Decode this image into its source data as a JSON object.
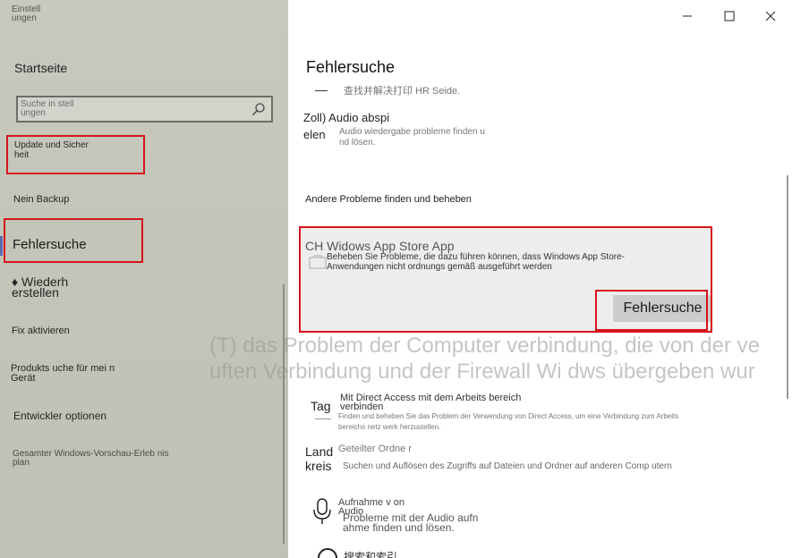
{
  "sidebar": {
    "app_title": "Einstell ungen",
    "home": "Startseite",
    "search_placeholder": "Suche in stell ungen",
    "items": {
      "update": "Update und Sicher heit",
      "backup": "Nein Backup",
      "troubleshoot": "Fehlersuche",
      "recovery": "♦ Wiederh erstellen",
      "activation": "Fix aktivieren",
      "find_device": "Produkts uche für mei n Gerät",
      "developer": "Entwickler optionen",
      "insider": "Gesamter Windows-Vorschau-Erleb nis plan"
    }
  },
  "main": {
    "title": "Fehlersuche",
    "top_fragment": "查找并解决打印 HR Seide.",
    "audio": {
      "title": "Zoll) Audio abspi elen",
      "desc": "Audio wiedergabe probleme finden u nd lösen."
    },
    "other_heading": "Andere Probleme finden und beheben",
    "store_app": {
      "title": "CH Widows App Store App",
      "desc": "Beheben Sie Probleme, die dazu führen können, dass Windows App Store-Anwendungen nicht ordnungs gemäß ausgeführt werden",
      "button": "Fehlersuche"
    },
    "overlay_lines": [
      "(T) das Problem der Computer verbindung, die von der ve",
      "uften Verbindung und der Firewall Wi dws übergeben wur"
    ],
    "items": [
      {
        "icon_text": "Tag",
        "title": "Mit Direct Access mit dem Arbeits bereich verbinden",
        "desc": "Finden und beheben Sie das Problem der Verwendung von Direct Access, um eine Verbindung zum Arbeits bereichs netz werk herzustellen."
      },
      {
        "icon_text": "Land kreis",
        "title": "Geteilter Ordne r",
        "desc": "Suchen und Auflösen des Zugriffs auf Dateien und Ordner auf anderen Comp utern"
      },
      {
        "icon_name": "microphone-icon",
        "title": "Aufnahme v on Audio",
        "desc": "Probleme mit der Audio aufn ahme finden und lösen."
      }
    ],
    "bottom_fragment": "搜索和索引"
  }
}
